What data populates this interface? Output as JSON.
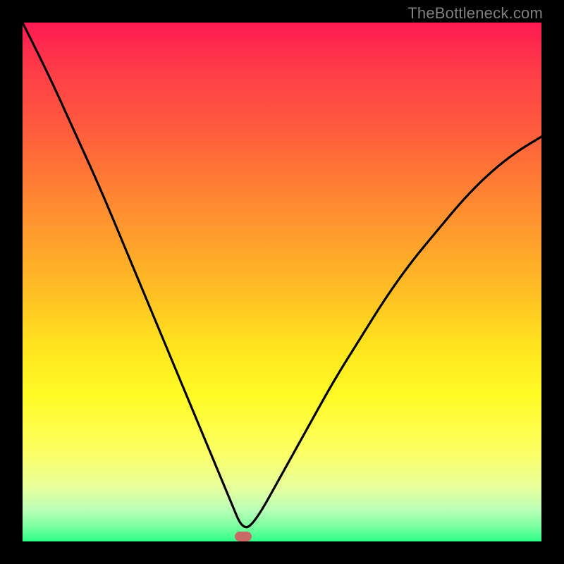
{
  "watermark": {
    "text": "TheBottleneck.com"
  },
  "colors": {
    "frame": "#000000",
    "curve": "#000000",
    "marker": "#c96a66",
    "gradient_top": "#ff1a52",
    "gradient_bottom": "#2dff8a"
  },
  "chart_data": {
    "type": "line",
    "title": "",
    "xlabel": "",
    "ylabel": "",
    "xlim": [
      0,
      100
    ],
    "ylim": [
      0,
      100
    ],
    "annotations": [
      {
        "type": "marker",
        "shape": "pill",
        "x": 42.5,
        "y": 1.0
      }
    ],
    "series": [
      {
        "name": "bottleneck-curve",
        "x": [
          0,
          5,
          10,
          15,
          20,
          25,
          30,
          35,
          40,
          42.5,
          45,
          50,
          55,
          60,
          65,
          70,
          75,
          80,
          85,
          90,
          95,
          100
        ],
        "values": [
          100,
          90,
          79,
          68,
          56,
          44,
          32,
          20,
          8,
          2,
          4,
          13,
          22,
          31,
          39,
          47,
          54,
          60,
          66,
          71,
          75,
          78
        ]
      }
    ]
  }
}
